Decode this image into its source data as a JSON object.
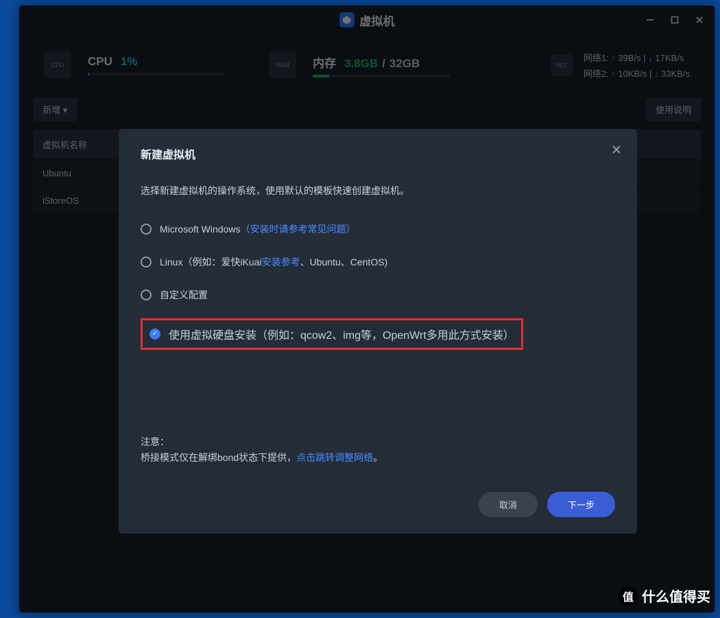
{
  "title": "虚拟机",
  "stats": {
    "cpu": {
      "label": "CPU",
      "value": "1%",
      "percent": 1
    },
    "mem": {
      "label": "内存",
      "used": "3.8GB",
      "sep": "/",
      "total": "32GB",
      "percent": 12
    }
  },
  "net": {
    "lines": [
      {
        "label": "网络1:",
        "up": "39B/s",
        "down": "17KB/s"
      },
      {
        "label": "网络2:",
        "up": "10KB/s",
        "down": "33KB/s"
      }
    ]
  },
  "toolbar": {
    "add": "新增",
    "help": "使用说明"
  },
  "table": {
    "header": "虚拟机名称",
    "rows": [
      "Ubuntu",
      "iStoreOS"
    ]
  },
  "modal": {
    "title": "新建虚拟机",
    "desc": "选择新建虚拟机的操作系统，使用默认的模板快速创建虚拟机。",
    "options": [
      {
        "label": "Microsoft Windows",
        "link_text": "（安装时请参考常见问题）",
        "checked": false
      },
      {
        "prefix": "Linux（例如：爱快iKuai",
        "link_text": "安装参考",
        "suffix": "、Ubuntu、CentOS)",
        "checked": false
      },
      {
        "label": "自定义配置",
        "checked": false
      },
      {
        "label": "使用虚拟硬盘安装（例如：qcow2、img等，OpenWrt多用此方式安装）",
        "checked": true,
        "highlighted": true
      }
    ],
    "note_label": "注意：",
    "note_text": "桥接模式仅在解绑bond状态下提供，",
    "note_link": "点击跳转调整网络",
    "note_period": "。",
    "cancel": "取消",
    "next": "下一步"
  },
  "watermark": "什么值得买"
}
